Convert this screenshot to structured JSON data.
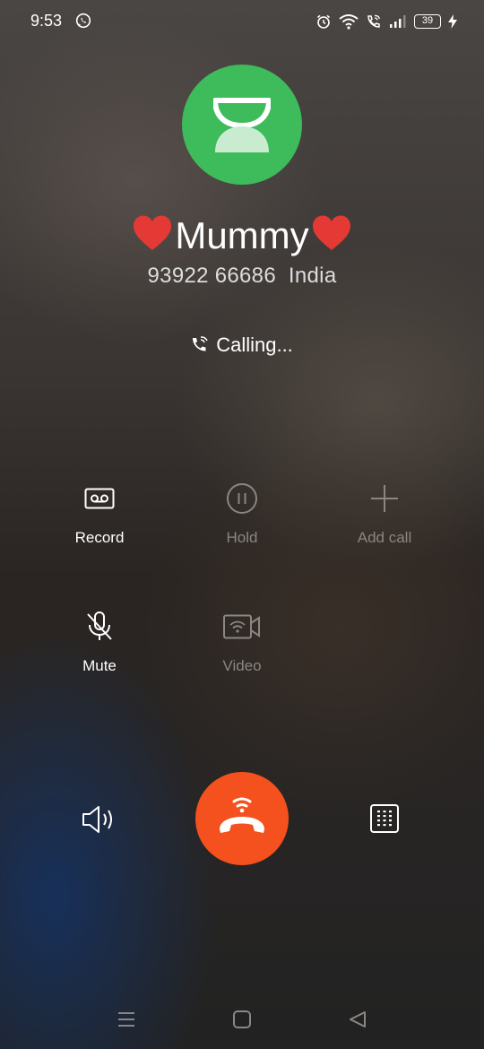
{
  "status_bar": {
    "time": "9:53",
    "battery": "39",
    "icons": [
      "whatsapp-icon",
      "alarm-icon",
      "wifi-icon",
      "wifi-call-icon",
      "signal-icon",
      "battery-icon",
      "charging-icon"
    ]
  },
  "contact": {
    "name": "Mummy",
    "name_emoji": "❤",
    "number": "93922 66686",
    "location": "India",
    "avatar_color": "#3ebb5a"
  },
  "call": {
    "status": "Calling..."
  },
  "controls": {
    "record": "Record",
    "hold": "Hold",
    "add_call": "Add call",
    "mute": "Mute",
    "video": "Video"
  },
  "actions": {
    "end_call_color": "#f4511e"
  },
  "nav": {
    "icons": [
      "menu-icon",
      "home-icon",
      "back-icon"
    ]
  }
}
